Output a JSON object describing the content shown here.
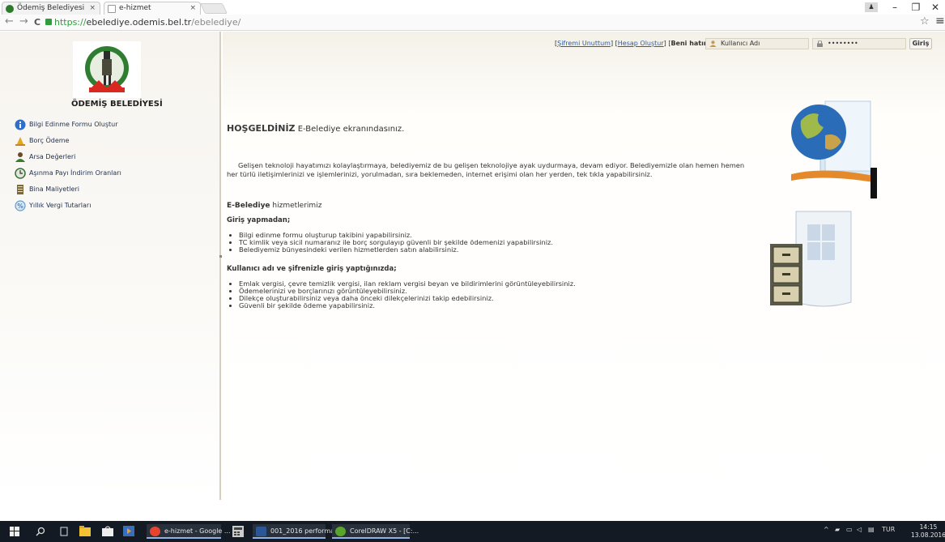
{
  "browser": {
    "tabs": [
      {
        "label": "Ödemiş Belediyesi",
        "close": "×"
      },
      {
        "label": "e-hizmet",
        "close": "×"
      }
    ],
    "window_controls": {
      "minimize": "–",
      "maximize": "❐",
      "close": "✕"
    },
    "nav": {
      "back": "←",
      "forward": "→",
      "reload": "C"
    },
    "url": {
      "scheme": "https://",
      "host": "ebelediye.odemis.bel.tr",
      "path": "/ebelediye/"
    },
    "star": "☆",
    "menu": "≡"
  },
  "sidebar": {
    "logo_title": "ÖDEMİŞ BELEDİYESİ",
    "items": [
      {
        "label": "Bilgi Edinme Formu Oluştur",
        "icon": "info-icon",
        "color": "#2f6fc8"
      },
      {
        "label": "Borç Ödeme",
        "icon": "money-bag-icon",
        "color": "#e3a81f"
      },
      {
        "label": "Arsa Değerleri",
        "icon": "user-icon",
        "color": "#3a7d2c"
      },
      {
        "label": "Aşınma Payı İndirim Oranları",
        "icon": "clock-icon",
        "color": "#3d6e3a"
      },
      {
        "label": "Bina Maliyetleri",
        "icon": "book-icon",
        "color": "#7a6a3a"
      },
      {
        "label": "Yıllık Vergi Tutarları",
        "icon": "percent-icon",
        "color": "#5f9bd0"
      }
    ]
  },
  "login": {
    "forgot": "Şifremi Unuttum",
    "create": "Hesap Oluştur",
    "remember": "Beni hatırla",
    "username_placeholder": "Kullanıcı Adı",
    "password_value": "••••••••",
    "submit": "Giriş"
  },
  "content": {
    "welcome_title": "HOŞGELDİNİZ",
    "welcome_text": "E-Belediye ekranındasınız.",
    "intro": "Gelişen teknoloji hayatımızı kolaylaştırmaya, belediyemiz de bu gelişen teknolojiye ayak uydurmaya, devam ediyor. Belediyemizle olan hemen hemen her türlü iletişimlerinizi ve işlemlerinizi, yorulmadan, sıra beklemeden, internet erişimi olan her yerden, tek tıkla yapabilirsiniz.",
    "services_bold": "E-Belediye",
    "services_text": "hizmetlerimiz",
    "section1_title": "Giriş yapmadan;",
    "section1_items": [
      "Bilgi edinme formu oluşturup takibini yapabilirsiniz.",
      "TC kimlik veya sicil numaranız ile borç sorgulayıp güvenli bir şekilde ödemenizi yapabilirsiniz.",
      "Belediyemiz bünyesindeki verilen hizmetlerden satın alabilirsiniz."
    ],
    "section2_title": "Kullanıcı adı ve şifrenizle giriş yaptığınızda;",
    "section2_items": [
      "Emlak vergisi, çevre temizlik vergisi, ilan reklam vergisi beyan ve bildirimlerini görüntüleyebilirsiniz.",
      "Ödemelerinizi ve borçlarınızı görüntüleyebilirsiniz.",
      "Dilekçe oluşturabilirsiniz veya daha önceki dilekçelerinizi takip edebilirsiniz.",
      "Güvenli bir şekilde ödeme yapabilirsiniz."
    ]
  },
  "taskbar": {
    "apps": [
      {
        "label": "e-hizmet - Google ...",
        "color": "#e7442f"
      },
      {
        "label": "001_2016 performa...",
        "color": "#2b5797"
      },
      {
        "label": "CorelDRAW X5 - [C:...",
        "color": "#58a42c"
      }
    ],
    "lang": "TUR",
    "time": "14:15",
    "date": "13.08.2016"
  }
}
